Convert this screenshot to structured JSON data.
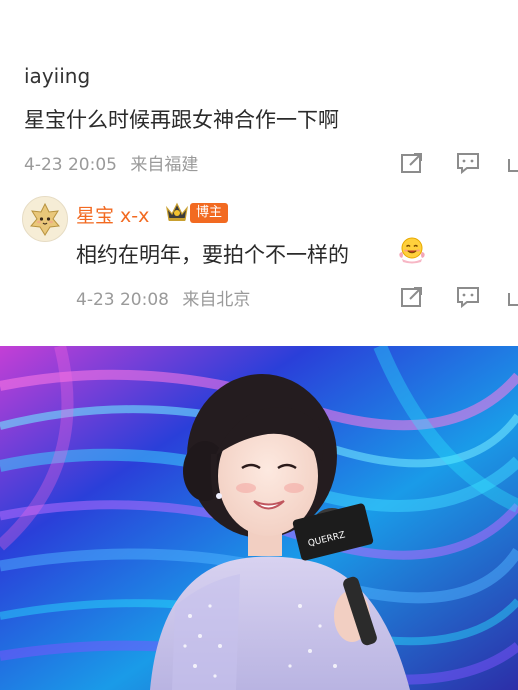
{
  "comment": {
    "username": "iayiing",
    "text": "星宝什么时候再跟女神合作一下啊",
    "timestamp": "4-23 20:05",
    "location": "来自福建"
  },
  "reply": {
    "username": "星宝 x-x",
    "badge": "博主",
    "text": "相约在明年，要拍个不一样的",
    "timestamp": "4-23 20:08",
    "location": "来自北京"
  },
  "icons": {
    "share": "share-icon",
    "reply": "comment-icon",
    "like": "like-icon",
    "crown": "crown-icon",
    "emoji": "smiling-emoji-icon"
  },
  "colors": {
    "username_highlight": "#f26a21",
    "meta_text": "#9a9a9a",
    "body_text": "#2a2a2a"
  },
  "photo": {
    "mic_flag_text": "QUERRZ"
  }
}
